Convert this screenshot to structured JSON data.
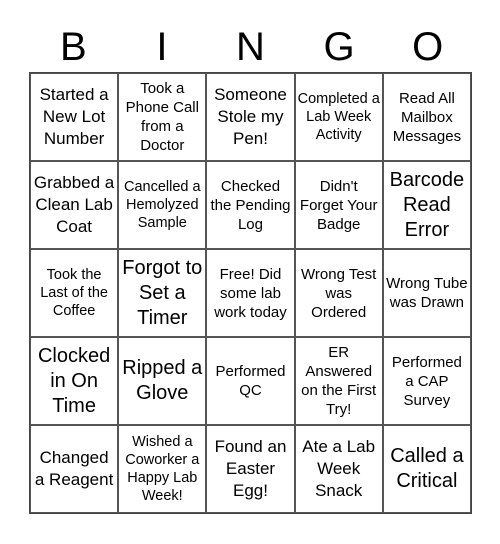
{
  "header": [
    "B",
    "I",
    "N",
    "G",
    "O"
  ],
  "cells": [
    [
      "Started a New Lot Number",
      "Took a Phone Call from a Doctor",
      "Someone Stole my Pen!",
      "Completed a Lab Week Activity",
      "Read All Mailbox Messages"
    ],
    [
      "Grabbed a Clean Lab Coat",
      "Cancelled a Hemolyzed Sample",
      "Checked the Pending Log",
      "Didn't Forget Your Badge",
      "Barcode Read Error"
    ],
    [
      "Took the Last of the Coffee",
      "Forgot to Set a Timer",
      "Free! Did some lab work today",
      "Wrong Test was Ordered",
      "Wrong Tube was Drawn"
    ],
    [
      "Clocked in On Time",
      "Ripped a Glove",
      "Performed QC",
      "ER Answered on the First Try!",
      "Performed a CAP Survey"
    ],
    [
      "Changed a Reagent",
      "Wished a Coworker a Happy Lab Week!",
      "Found an Easter Egg!",
      "Ate a Lab Week Snack",
      "Called a Critical"
    ]
  ]
}
